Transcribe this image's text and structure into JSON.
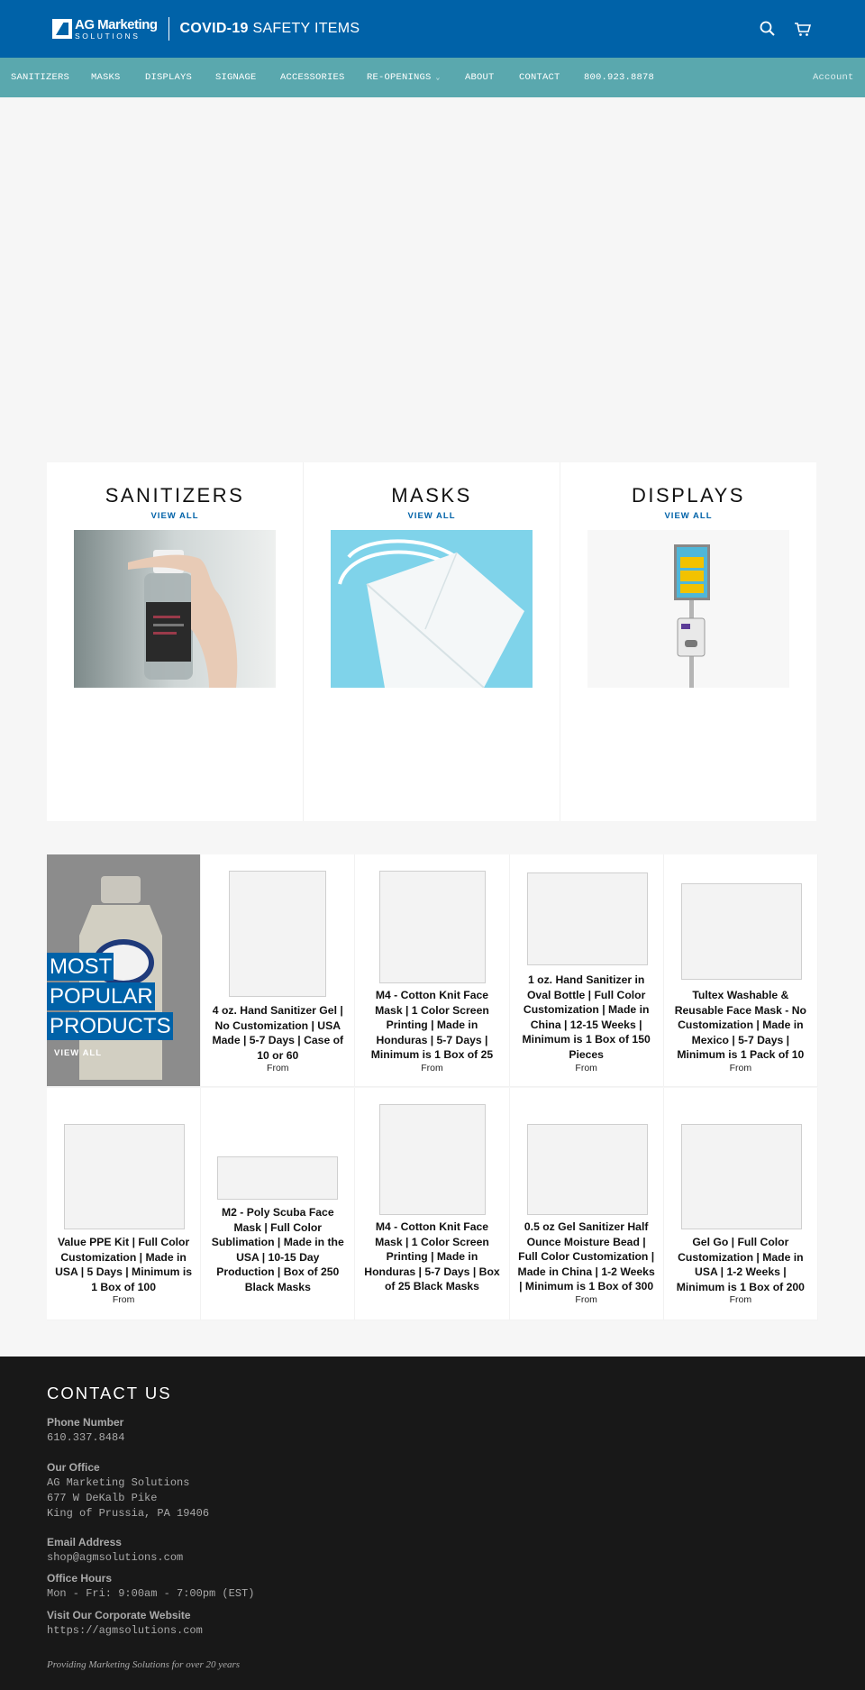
{
  "header": {
    "logo_line1": "AG Marketing",
    "logo_line2": "SOLUTIONS",
    "tag_bold": "COVID-19",
    "tag_rest": "SAFETY ITEMS",
    "search_icon": "search-icon",
    "cart_icon": "cart-icon",
    "bg_color": "#0062a8"
  },
  "nav": {
    "items": [
      "SANITIZERS",
      "MASKS",
      "DISPLAYS",
      "SIGNAGE",
      "ACCESSORIES",
      "RE-OPENINGS",
      "ABOUT",
      "CONTACT",
      "800.923.8878"
    ],
    "dropdown_icon": "chevron-down-icon",
    "account": "Account",
    "bg_color": "#5aa8ae"
  },
  "collections": [
    {
      "title": "SANITIZERS",
      "link": "VIEW ALL"
    },
    {
      "title": "MASKS",
      "link": "VIEW ALL"
    },
    {
      "title": "DISPLAYS",
      "link": "VIEW ALL"
    }
  ],
  "featured": {
    "line1": "MOST",
    "line2": "POPULAR",
    "line3": "PRODUCTS",
    "link": "VIEW ALL"
  },
  "products": [
    {
      "title": "4 oz. Hand Sanitizer Gel | No Customization | USA Made | 5-7 Days | Case of 10 or 60",
      "price": "From"
    },
    {
      "title": "M4 - Cotton Knit Face Mask | 1 Color Screen Printing | Made in Honduras | 5-7 Days | Minimum is 1 Box of 25",
      "price": "From"
    },
    {
      "title": "1 oz. Hand Sanitizer in Oval Bottle | Full Color Customization | Made in China | 12-15 Weeks | Minimum is 1 Box of 150 Pieces",
      "price": "From"
    },
    {
      "title": "Tultex Washable & Reusable Face Mask - No Customization | Made in Mexico | 5-7 Days | Minimum is 1 Pack of 10",
      "price": "From"
    },
    {
      "title": "Value PPE Kit | Full Color Customization | Made in USA | 5 Days | Minimum is 1 Box of 100",
      "price": "From"
    },
    {
      "title": "M2 - Poly Scuba Face Mask | Full Color Sublimation | Made in the USA | 10-15 Day Production | Box of 250 Black Masks",
      "price": ""
    },
    {
      "title": "M4 - Cotton Knit Face Mask | 1 Color Screen Printing | Made in Honduras | 5-7 Days | Box of 25 Black Masks",
      "price": ""
    },
    {
      "title": "0.5 oz Gel Sanitizer Half Ounce Moisture Bead | Full Color Customization | Made in China | 1-2 Weeks | Minimum is 1 Box of 300",
      "price": "From"
    },
    {
      "title": "Gel Go | Full Color Customization | Made in USA | 1-2 Weeks | Minimum is 1 Box of 200",
      "price": "From"
    }
  ],
  "footer": {
    "title": "CONTACT US",
    "phone_label": "Phone Number",
    "phone": "610.337.8484",
    "office_label": "Our Office",
    "office_line1": "AG Marketing Solutions",
    "office_line2": "677 W DeKalb Pike",
    "office_line3": "King of Prussia, PA 19406",
    "email_label": "Email Address",
    "email": "shop@agmsolutions.com",
    "hours_label": "Office Hours",
    "hours": "Mon - Fri: 9:00am - 7:00pm (EST)",
    "site_label": "Visit Our Corporate Website",
    "site": "https://agmsolutions.com",
    "tagline": "Providing Marketing Solutions for over 20 years"
  }
}
